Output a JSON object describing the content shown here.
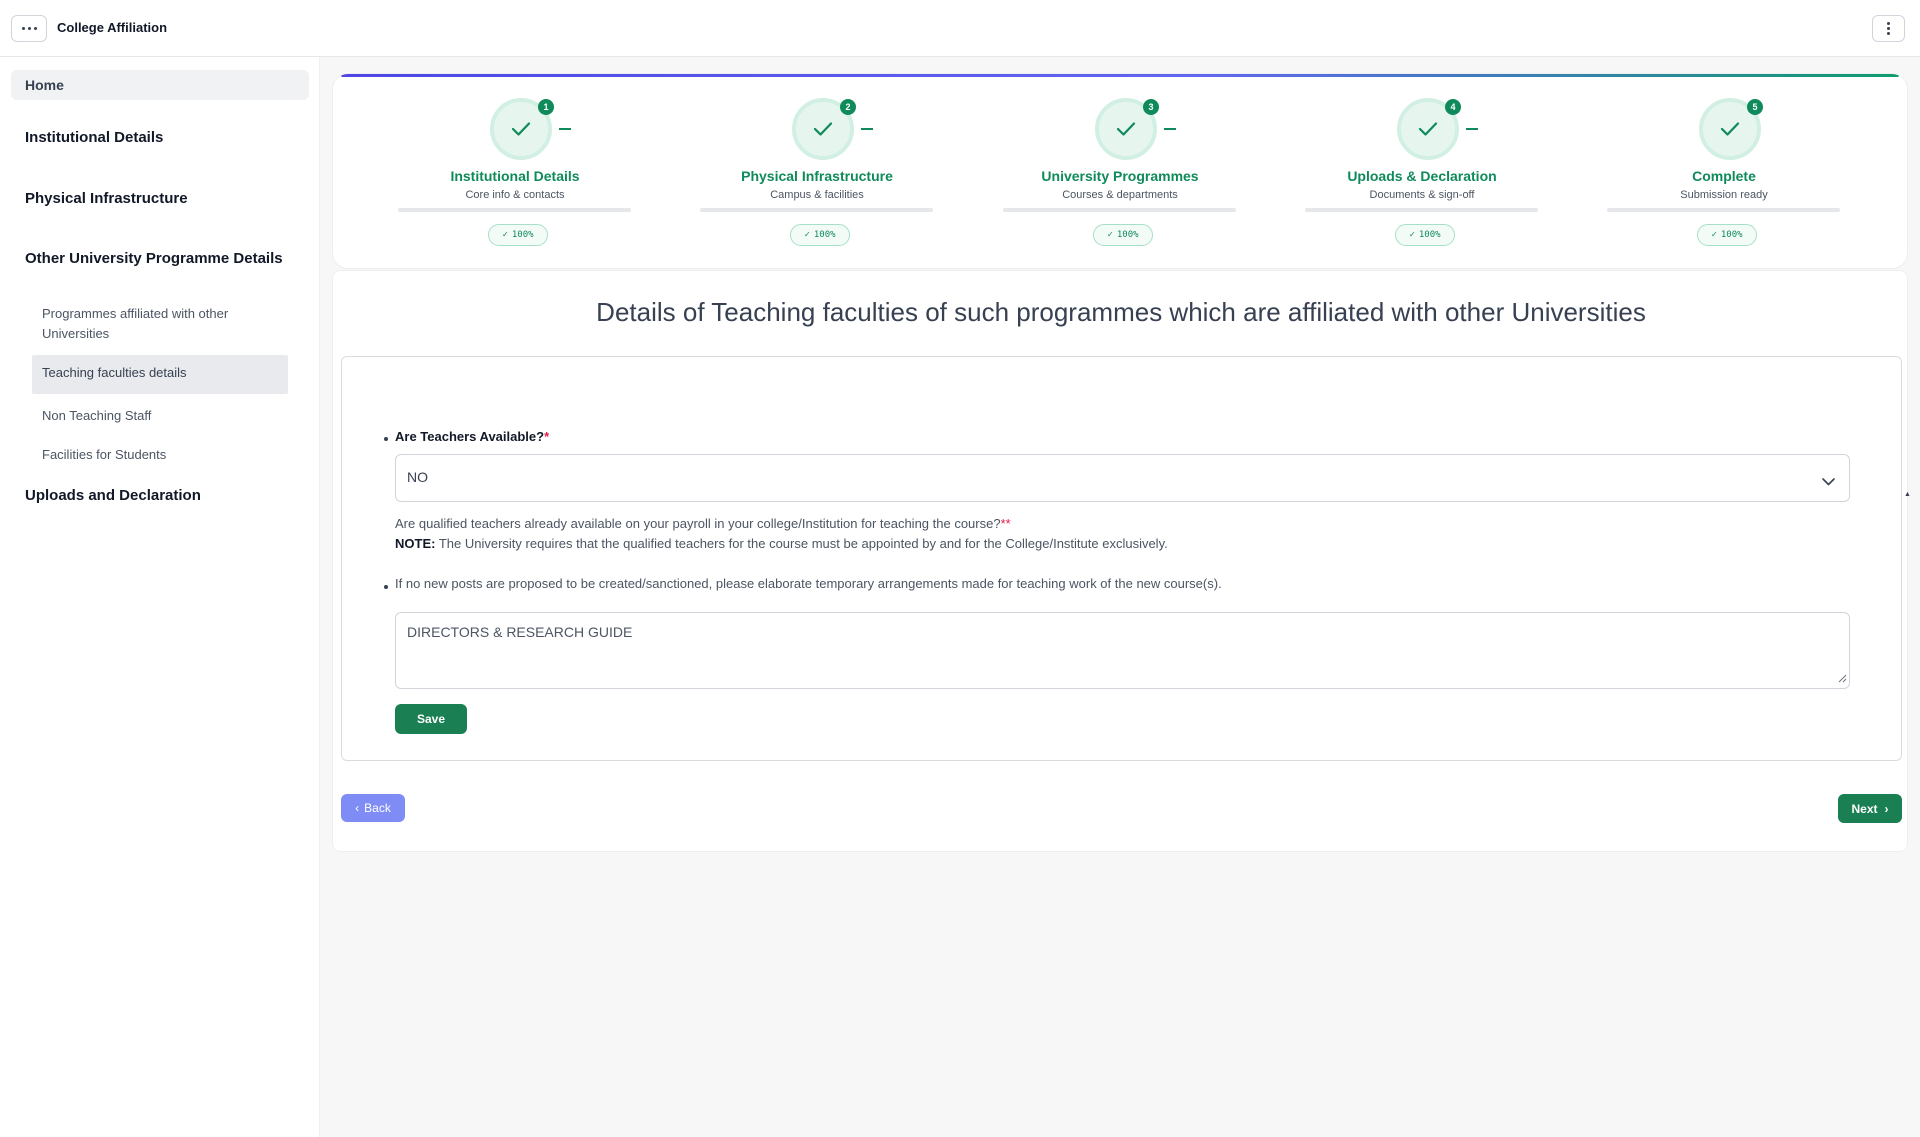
{
  "app": {
    "title": "College Affiliation",
    "icons": {
      "menu": "ellipsis-icon",
      "more": "vertical-dots-icon"
    }
  },
  "sidebar": {
    "home": "Home",
    "sections": [
      {
        "label": "Institutional Details"
      },
      {
        "label": "Physical Infrastructure"
      },
      {
        "label": "Other University Programme Details"
      },
      {
        "label": "Uploads and Declaration"
      }
    ],
    "subitems": [
      {
        "label": "Programmes affiliated with other Universities"
      },
      {
        "label": "Teaching faculties details",
        "active": true
      },
      {
        "label": "Non Teaching Staff"
      },
      {
        "label": "Facilities for Students"
      }
    ]
  },
  "stepper": {
    "accent": "#0f8a5a",
    "steps": [
      {
        "number": "1",
        "title": "Institutional Details",
        "subtitle": "Core info & contacts",
        "percent": "100%"
      },
      {
        "number": "2",
        "title": "Physical Infrastructure",
        "subtitle": "Campus & facilities",
        "percent": "100%"
      },
      {
        "number": "3",
        "title": "University Programmes",
        "subtitle": "Courses & departments",
        "percent": "100%"
      },
      {
        "number": "4",
        "title": "Uploads & Declaration",
        "subtitle": "Documents & sign-off",
        "percent": "100%"
      },
      {
        "number": "5",
        "title": "Complete",
        "subtitle": "Submission ready",
        "percent": "100%"
      }
    ]
  },
  "form": {
    "title": "Details of Teaching faculties of such programmes which are affiliated with other Universities",
    "teachers_question": "Are Teachers Available?",
    "required_mark": "*",
    "teachers_value": "NO",
    "help_text": "Are qualified teachers already available on your payroll in your college/Institution for teaching the course?",
    "help_required_mark": "**",
    "note_label": "NOTE:",
    "note_text": "The University requires that the qualified teachers for the course must be appointed by and for the College/Institute exclusively.",
    "arrangements_question": "If no new posts are proposed to be created/sanctioned, please elaborate temporary arrangements made for teaching work of the new course(s).",
    "arrangements_value": "DIRECTORS & RESEARCH GUIDE",
    "save_label": "Save"
  },
  "nav": {
    "back_label": "Back",
    "next_label": "Next"
  }
}
